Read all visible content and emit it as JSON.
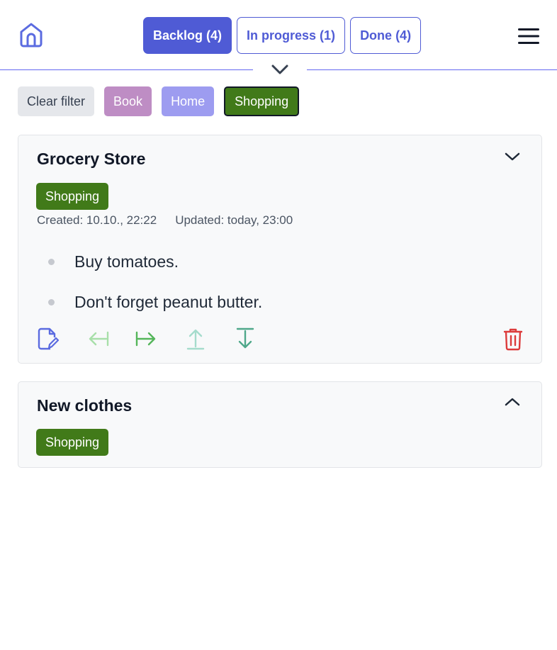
{
  "header": {
    "home_icon": "home-icon",
    "menu_icon": "hamburger-menu-icon",
    "collapse_icon": "chevron-down-icon",
    "tabs": [
      {
        "label": "Backlog (4)",
        "active": true
      },
      {
        "label": "In progress (1)",
        "active": false
      },
      {
        "label": "Done (4)",
        "active": false
      }
    ]
  },
  "filters": {
    "clear_label": "Clear filter",
    "categories": [
      {
        "label": "Book",
        "color": "#be8dc4"
      },
      {
        "label": "Home",
        "color": "#9d9cf0"
      },
      {
        "label": "Shopping",
        "color": "#417a19",
        "selected": true
      }
    ]
  },
  "cards": [
    {
      "title": "Grocery Store",
      "tag": "Shopping",
      "created": "Created: 10.10., 22:22",
      "updated": "Updated: today, 23:00",
      "expanded": true,
      "items": [
        "Buy tomatoes.",
        "Don't forget peanut butter."
      ],
      "actions": [
        "edit-icon",
        "move-left-icon",
        "move-right-icon",
        "move-top-icon",
        "move-bottom-icon",
        "delete-icon"
      ]
    },
    {
      "title": "New clothes",
      "tag": "Shopping",
      "expanded": false
    }
  ],
  "colors": {
    "accent": "#4f5bd5",
    "shopping": "#417a19",
    "delete": "#dc3b3b",
    "move": "#6cc070"
  }
}
